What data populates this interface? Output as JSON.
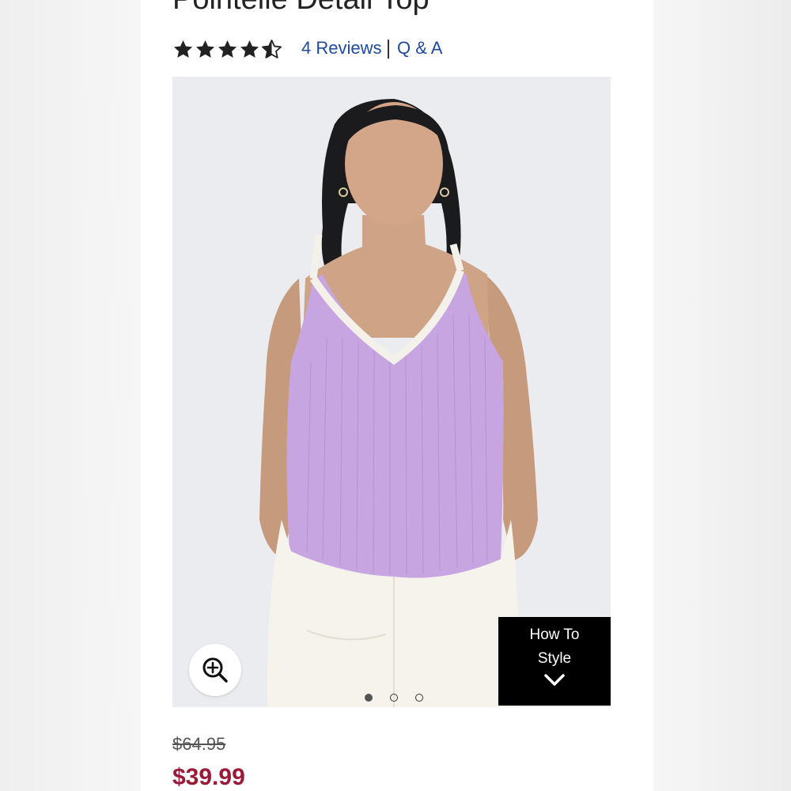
{
  "product": {
    "title": "Pointelle Detail Top",
    "rating": 4.5,
    "reviews_label": "4 Reviews",
    "qa_label": "Q & A",
    "original_price": "$64.95",
    "sale_price": "$39.99"
  },
  "gallery": {
    "current_index": 1,
    "total_images": 3,
    "zoom_icon": "zoom-in-icon",
    "how_to_style_line1": "How To",
    "how_to_style_line2": "Style",
    "how_to_style_icon": "chevron-down-icon"
  },
  "colors": {
    "star": "#222222",
    "link": "#1f4aa0",
    "sale_price": "#9b1a3a",
    "tank_top": "#c6a5e0"
  }
}
